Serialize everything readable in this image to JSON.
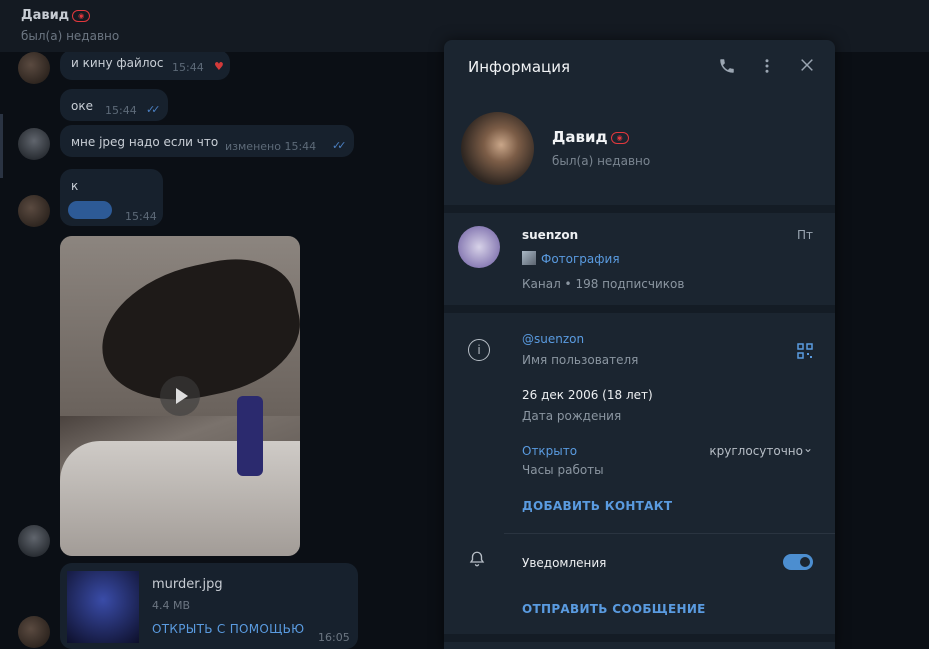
{
  "header": {
    "name": "Давид",
    "status": "был(а) недавно"
  },
  "messages": [
    {
      "text": "и кину файлос",
      "time": "15:44"
    },
    {
      "text": "оке",
      "time": "15:44"
    },
    {
      "text": "мне jpeg надо если что",
      "time": "изменено 15:44"
    },
    {
      "text": "к",
      "time": "15:44"
    }
  ],
  "file": {
    "name": "murder.jpg",
    "size": "4.4 MB",
    "open_label": "ОТКРЫТЬ С ПОМОЩЬЮ",
    "time": "16:05"
  },
  "panel": {
    "title": "Информация",
    "profile": {
      "name": "Давид",
      "status": "был(а) недавно"
    },
    "channel": {
      "name": "suenzon",
      "day": "Пт",
      "photo_label": "Фотография",
      "meta": "Канал • 198 подписчиков"
    },
    "info": {
      "username": "@suenzon",
      "username_label": "Имя пользователя",
      "birthday": "26 дек 2006 (18 лет)",
      "birthday_label": "Дата рождения",
      "open_status": "Открыто",
      "hours": "круглосуточно",
      "hours_label": "Часы работы",
      "add_contact": "ДОБАВИТЬ КОНТАКТ"
    },
    "notifications": {
      "label": "Уведомления",
      "enabled": true,
      "send_message": "ОТПРАВИТЬ СООБЩЕНИЕ"
    }
  },
  "icons": {
    "phone": "phone-icon",
    "more": "more-vertical-icon",
    "close": "close-icon",
    "info": "info-icon",
    "qr": "qr-code-icon",
    "bell": "bell-icon"
  },
  "colors": {
    "accent": "#5a9be0",
    "panel_bg": "#1b2530",
    "chat_bg": "#0b0f15"
  }
}
